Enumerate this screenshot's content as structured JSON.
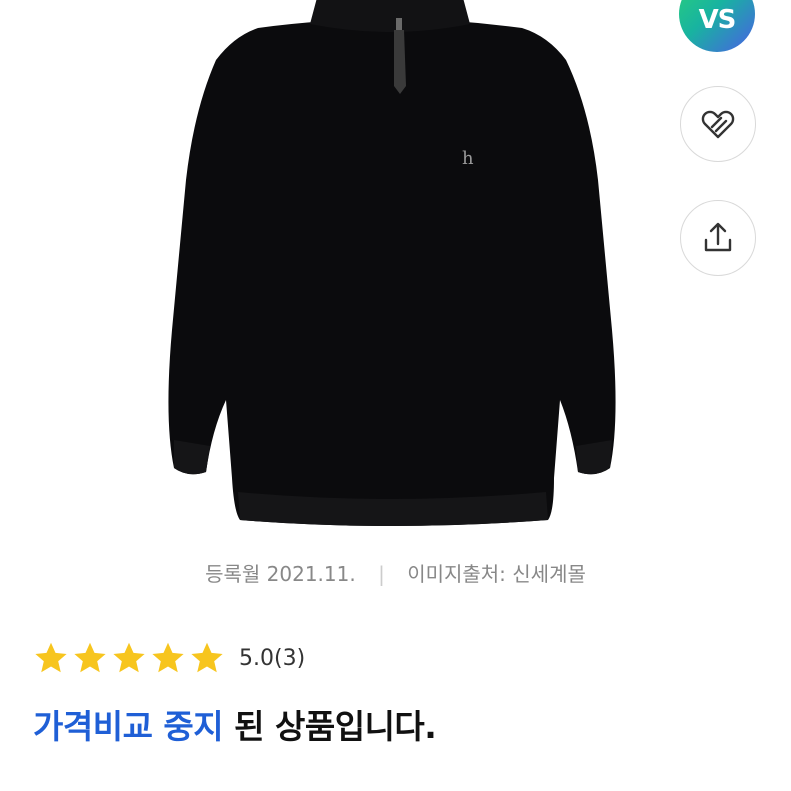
{
  "product": {
    "image_icon": "sweater-image",
    "logo_letter": "h"
  },
  "actions": {
    "vs_label": "VS",
    "wishlist_icon": "heart-tag-icon",
    "share_icon": "share-icon"
  },
  "meta": {
    "registered": "등록월 2021.11.",
    "divider": "|",
    "image_source": "이미지출처: 신세계몰"
  },
  "rating": {
    "stars": 5,
    "max_stars": 5,
    "score": "5.0",
    "count": "(3)",
    "star_color": "#f7c51e"
  },
  "status": {
    "highlight": "가격비교 중지",
    "rest": " 된 상품입니다.",
    "accent_color": "#1f5fd6"
  }
}
